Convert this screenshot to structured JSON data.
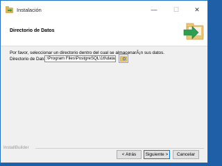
{
  "window": {
    "title": "Instalación",
    "minimize_glyph": "—",
    "maximize_glyph": "☐",
    "close_glyph": "✕"
  },
  "header": {
    "title": "Directorio de Datos",
    "icon": "folder-arrow-icon"
  },
  "body": {
    "instructions": "Por favor, seleccionar un directorio dentro del cual se almacenarÃ¡n sus datos.",
    "dir_label": "Directorio de Datos",
    "dir_value": ":\\Program Files\\PostgreSQL\\16\\data",
    "browse_icon": "browse-folder-icon"
  },
  "footer": {
    "brand": "InstallBuilder",
    "back_label": "< Atrás",
    "next_label": "Siguiente >",
    "cancel_label": "Cancelar"
  },
  "colors": {
    "accent": "#0078d7",
    "header_bg": "#ffffff",
    "panel_bg": "#f0f0f0",
    "arrow_green": "#2e9e52",
    "folder_tan": "#e8c77a"
  }
}
